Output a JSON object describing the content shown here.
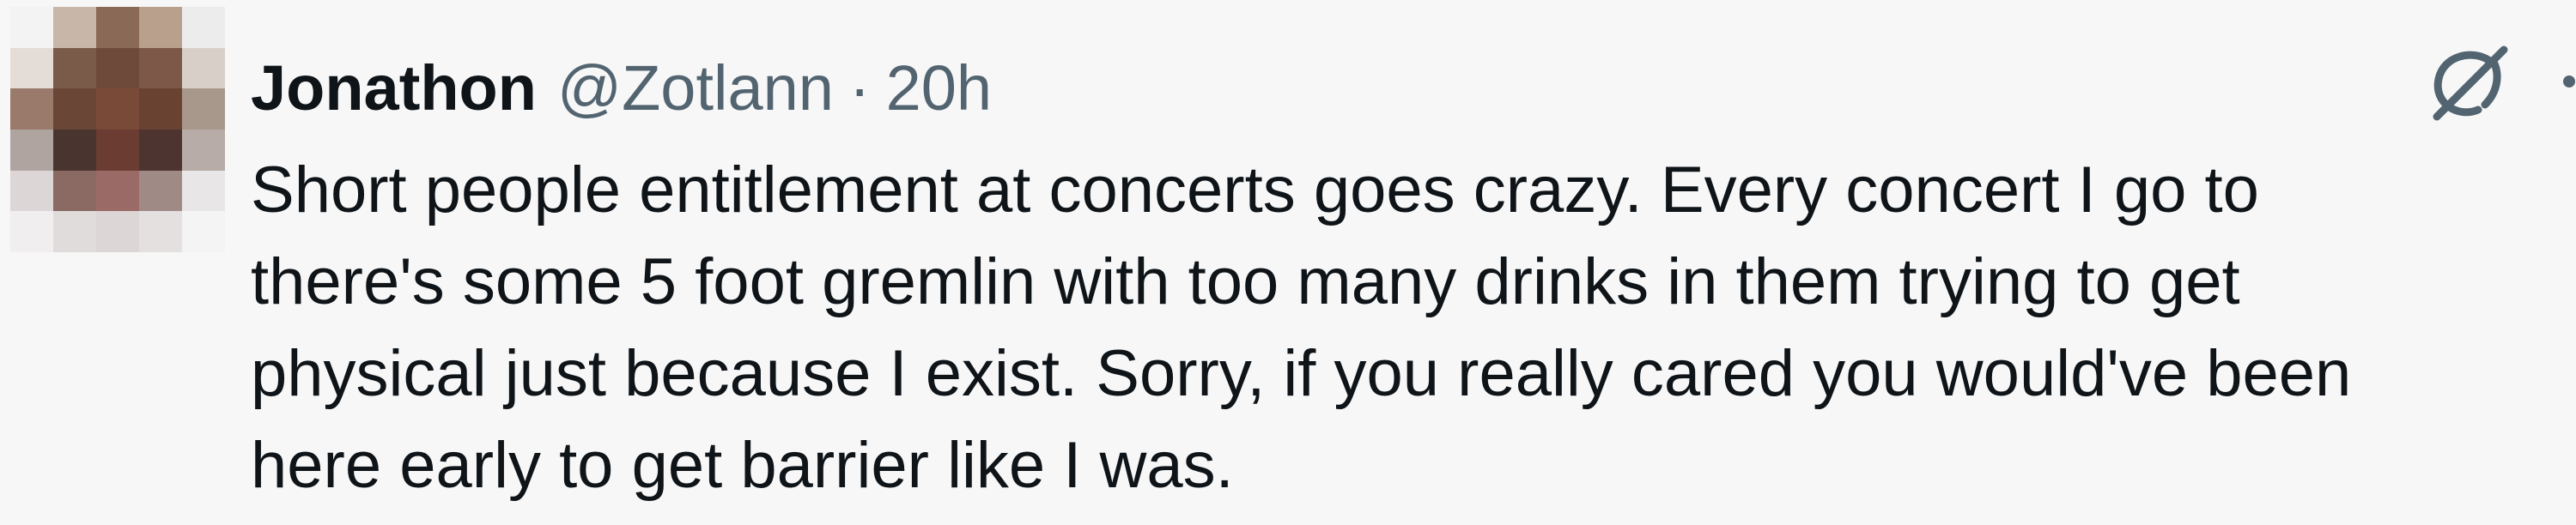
{
  "tweet": {
    "author_name": "Jonathon",
    "handle": "@Zotlann",
    "separator": "·",
    "timestamp": "20h",
    "text": "Short people entitlement at concerts goes crazy. Every concert I go to\nthere's some 5 foot gremlin with too many drinks in them trying to get\nphysical just because I exist. Sorry, if you really cared you would've been\nhere early to get barrier like I was."
  },
  "icons": {
    "action": "grok-icon",
    "more": "more-options-icon"
  },
  "colors": {
    "background": "#f7f7f7",
    "text_primary": "#0f1419",
    "text_secondary": "#536471"
  }
}
